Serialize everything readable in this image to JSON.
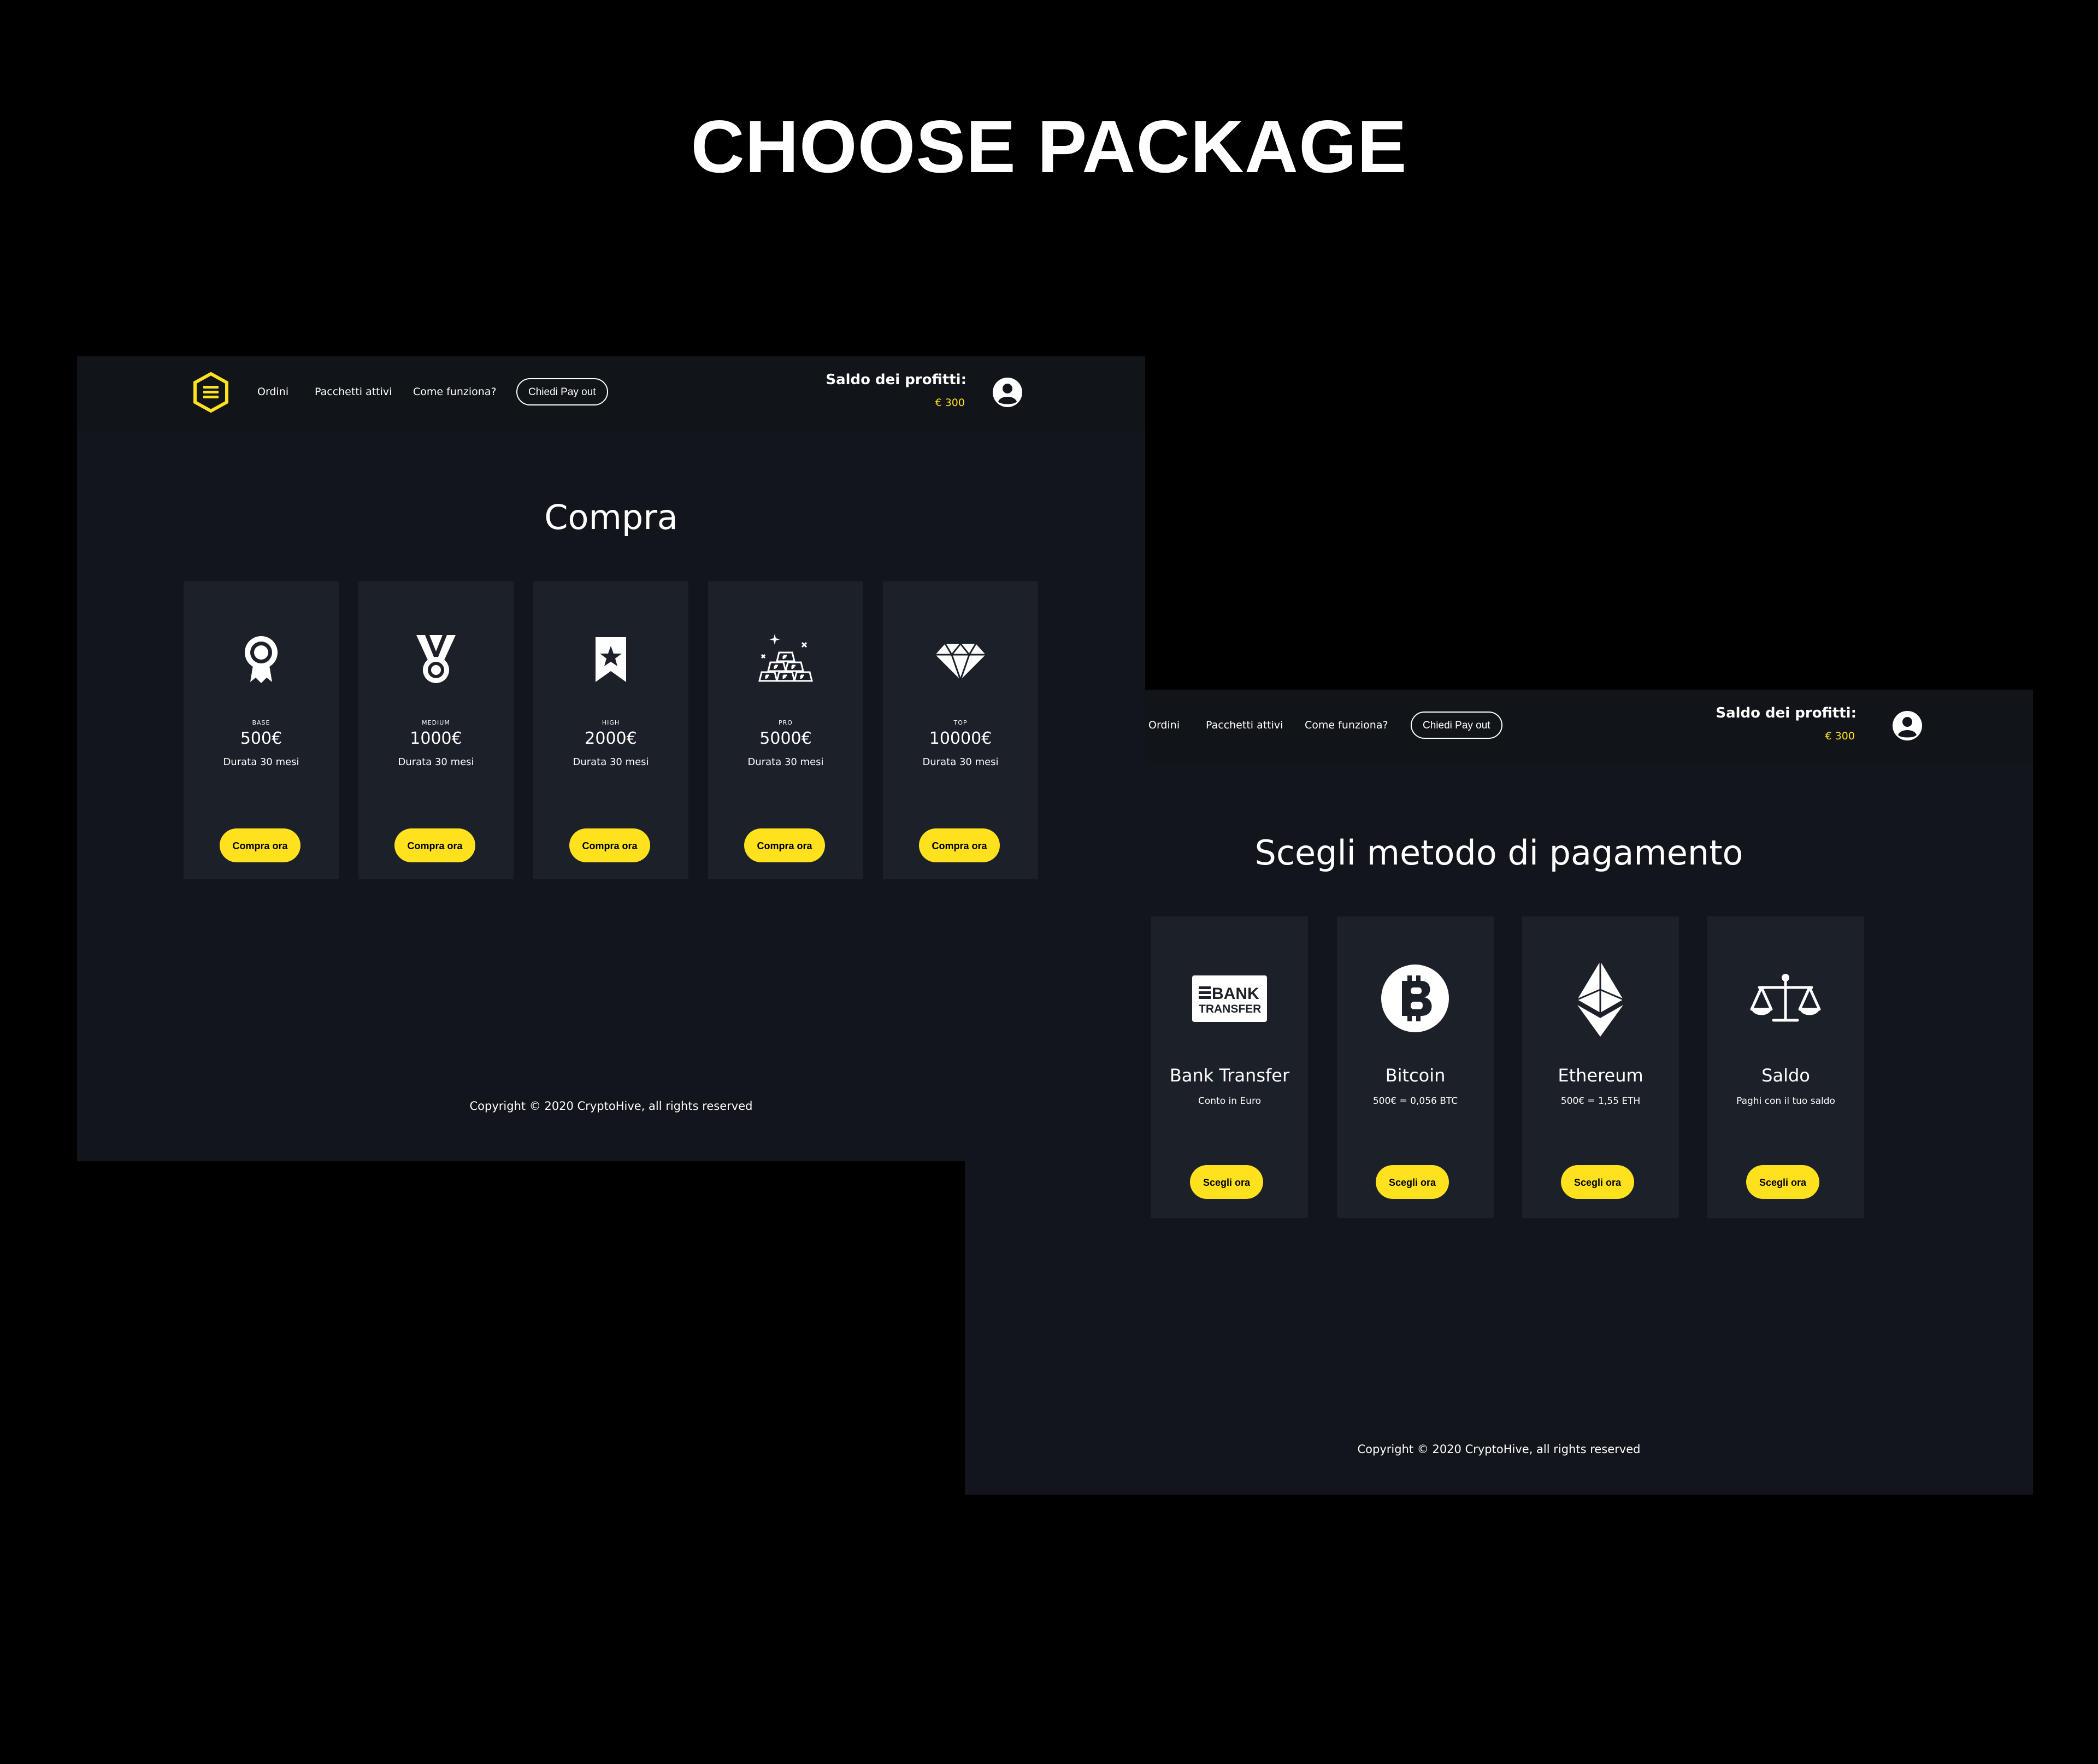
{
  "heading": "CHOOSE PACKAGE",
  "colors": {
    "background": "#000000",
    "screen": "#12151b",
    "card": "#1c2028",
    "accent": "#ffe11e"
  },
  "purchase_screen": {
    "logo": "hexagon-logo-icon",
    "nav": {
      "orders": "Ordini",
      "active_packages": "Pacchetti attivi",
      "how_it_works": "Come funziona?",
      "payout": "Chiedi Pay out"
    },
    "balance_label": "Saldo dei profitti:",
    "balance_value": "€ 300",
    "title": "Compra",
    "packages": [
      {
        "icon": "ribbon-badge-icon",
        "tier": "BASE",
        "price": "500€",
        "duration": "Durata 30 mesi",
        "button": "Compra ora"
      },
      {
        "icon": "medal-icon",
        "tier": "MEDIUM",
        "price": "1000€",
        "duration": "Durata 30 mesi",
        "button": "Compra ora"
      },
      {
        "icon": "bookmark-star-icon",
        "tier": "HIGH",
        "price": "2000€",
        "duration": "Durata 30 mesi",
        "button": "Compra ora"
      },
      {
        "icon": "gold-bars-icon",
        "tier": "PRO",
        "price": "5000€",
        "duration": "Durata 30 mesi",
        "button": "Compra ora"
      },
      {
        "icon": "diamond-icon",
        "tier": "TOP",
        "price": "10000€",
        "duration": "Durata 30 mesi",
        "button": "Compra ora"
      }
    ],
    "footer": "Copyright © 2020  CryptoHive, all rights reserved"
  },
  "payment_screen": {
    "nav": {
      "orders": "Ordini",
      "active_packages": "Pacchetti attivi",
      "how_it_works": "Come funziona?",
      "payout": "Chiedi Pay out"
    },
    "balance_label": "Saldo dei profitti:",
    "balance_value": "€ 300",
    "title": "Scegli metodo di pagamento",
    "methods": [
      {
        "icon": "bank-transfer-icon",
        "logo_line1": "BANK",
        "logo_line2": "TRANSFER",
        "name": "Bank Transfer",
        "sub": "Conto in Euro",
        "button": "Scegli ora"
      },
      {
        "icon": "bitcoin-icon",
        "name": "Bitcoin",
        "sub": "500€ = 0,056 BTC",
        "button": "Scegli ora"
      },
      {
        "icon": "ethereum-icon",
        "name": "Ethereum",
        "sub": "500€ = 1,55 ETH",
        "button": "Scegli ora"
      },
      {
        "icon": "scales-icon",
        "name": "Saldo",
        "sub": "Paghi con il tuo saldo",
        "button": "Scegli ora"
      }
    ],
    "footer": "Copyright © 2020  CryptoHive, all rights reserved"
  }
}
